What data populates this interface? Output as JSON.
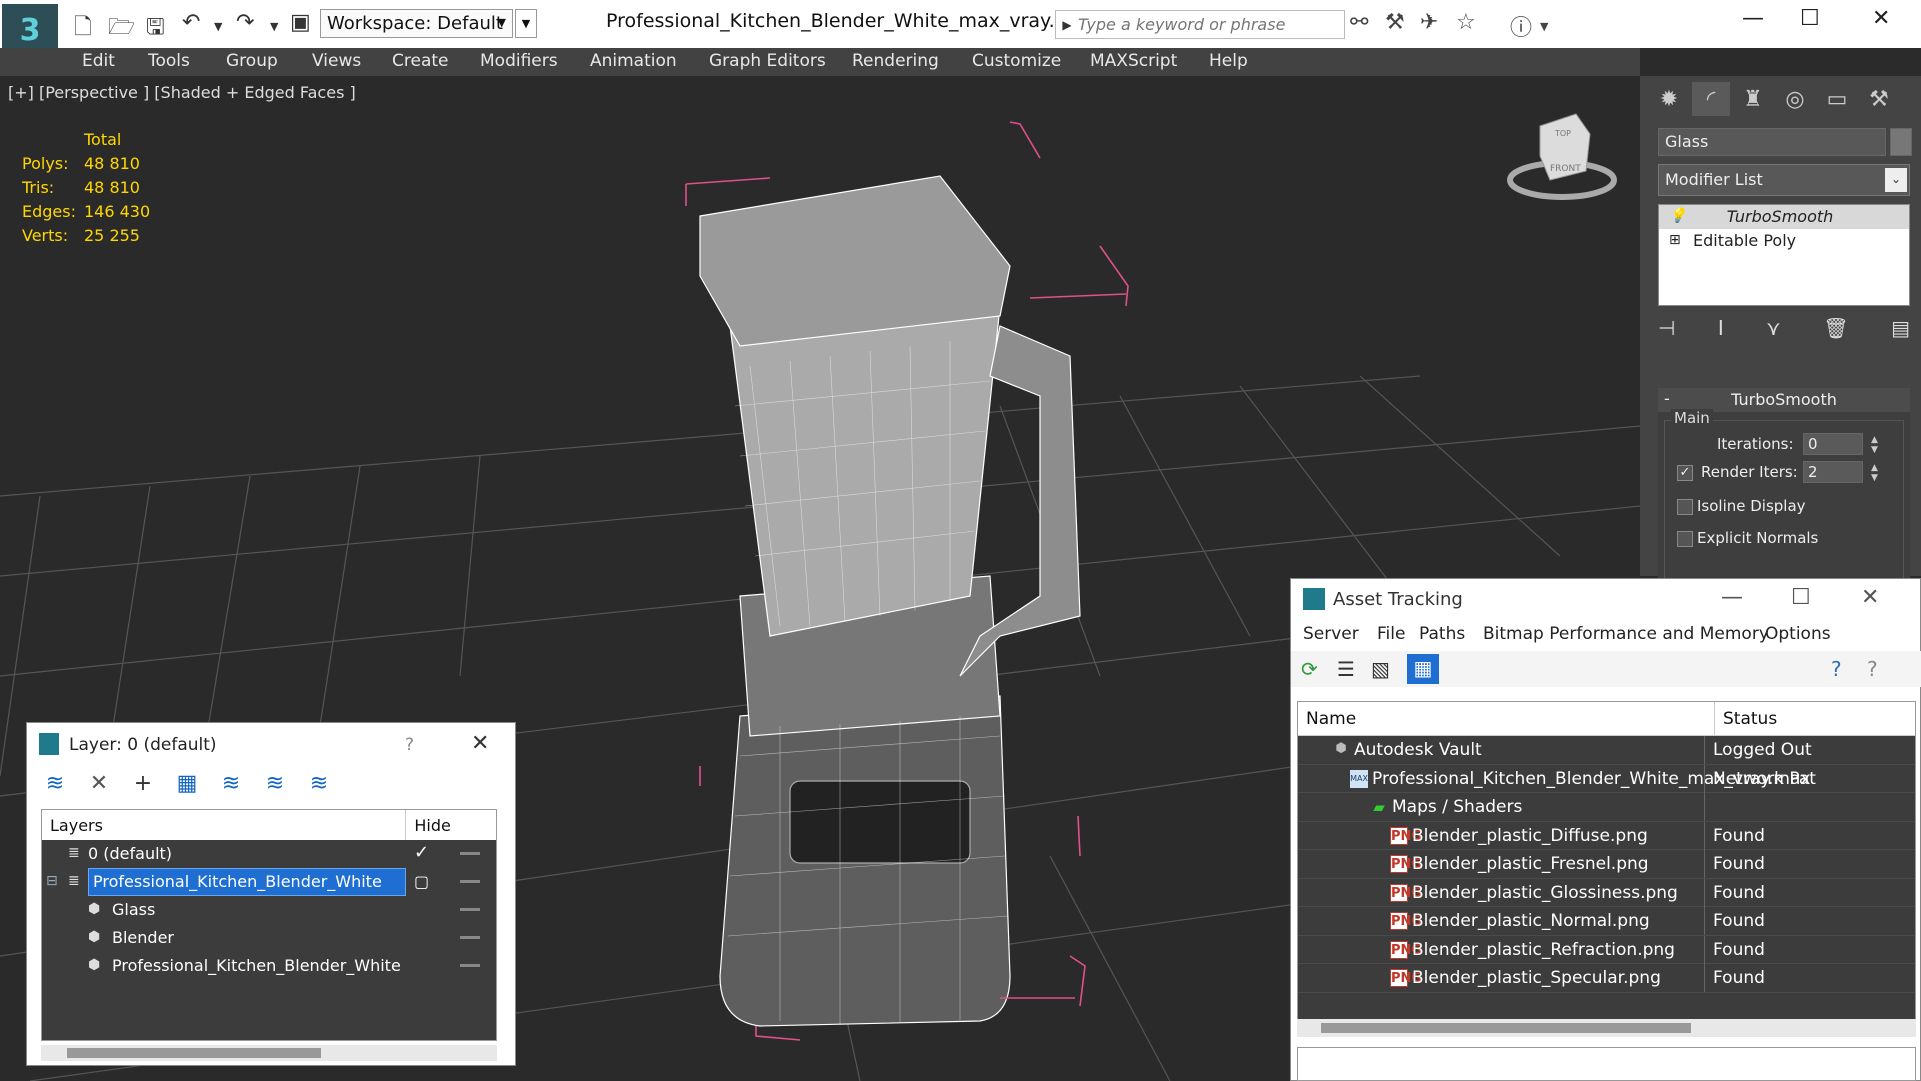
{
  "window": {
    "title": "Professional_Kitchen_Blender_White_max_vray.max",
    "workspace": "Workspace: Default",
    "search_placeholder": "Type a keyword or phrase"
  },
  "menu": [
    "Edit",
    "Tools",
    "Group",
    "Views",
    "Create",
    "Modifiers",
    "Animation",
    "Graph Editors",
    "Rendering",
    "Customize",
    "MAXScript",
    "Help"
  ],
  "viewport": {
    "label": "[+] [Perspective ] [Shaded + Edged Faces ]",
    "stats_header": "Total",
    "stats": [
      {
        "label": "Polys:",
        "value": "48 810"
      },
      {
        "label": "Tris:",
        "value": "48 810"
      },
      {
        "label": "Edges:",
        "value": "146 430"
      },
      {
        "label": "Verts:",
        "value": "25 255"
      }
    ],
    "viewcube": {
      "top": "TOP",
      "front": "FRONT"
    }
  },
  "command_panel": {
    "object_name": "Glass",
    "modifier_list": "Modifier List",
    "stack": [
      "TurboSmooth",
      "Editable Poly"
    ],
    "rollout_title": "TurboSmooth",
    "group_main": "Main",
    "iterations_label": "Iterations:",
    "iterations_value": "0",
    "render_iters_label": "Render Iters:",
    "render_iters_value": "2",
    "isoline_label": "Isoline Display",
    "explicit_normals_label": "Explicit Normals"
  },
  "layer_window": {
    "title": "Layer: 0 (default)",
    "help": "?",
    "col_layers": "Layers",
    "col_hide": "Hide",
    "rows": [
      {
        "name": "0 (default)",
        "level": 0
      },
      {
        "name": "Professional_Kitchen_Blender_White",
        "level": 0
      },
      {
        "name": "Glass",
        "level": 1
      },
      {
        "name": "Blender",
        "level": 1
      },
      {
        "name": "Professional_Kitchen_Blender_White",
        "level": 1
      }
    ]
  },
  "asset_window": {
    "title": "Asset Tracking",
    "menu": [
      "Server",
      "File",
      "Paths",
      "Bitmap Performance and Memory",
      "Options"
    ],
    "col_name": "Name",
    "col_status": "Status",
    "rows": [
      {
        "name": "Autodesk Vault",
        "status": "Logged Out",
        "level": 0
      },
      {
        "name": "Professional_Kitchen_Blender_White_max_vray.max",
        "status": "Network Pat",
        "level": 1
      },
      {
        "name": "Maps / Shaders",
        "status": "",
        "level": 2
      },
      {
        "name": "Blender_plastic_Diffuse.png",
        "status": "Found",
        "level": 3
      },
      {
        "name": "Blender_plastic_Fresnel.png",
        "status": "Found",
        "level": 3
      },
      {
        "name": "Blender_plastic_Glossiness.png",
        "status": "Found",
        "level": 3
      },
      {
        "name": "Blender_plastic_Normal.png",
        "status": "Found",
        "level": 3
      },
      {
        "name": "Blender_plastic_Refraction.png",
        "status": "Found",
        "level": 3
      },
      {
        "name": "Blender_plastic_Specular.png",
        "status": "Found",
        "level": 3
      }
    ],
    "png_badge": "PNG"
  },
  "colors": {
    "stats": "#ffd700",
    "selection": "#1e6fd1",
    "bbox": "#e0508a"
  }
}
